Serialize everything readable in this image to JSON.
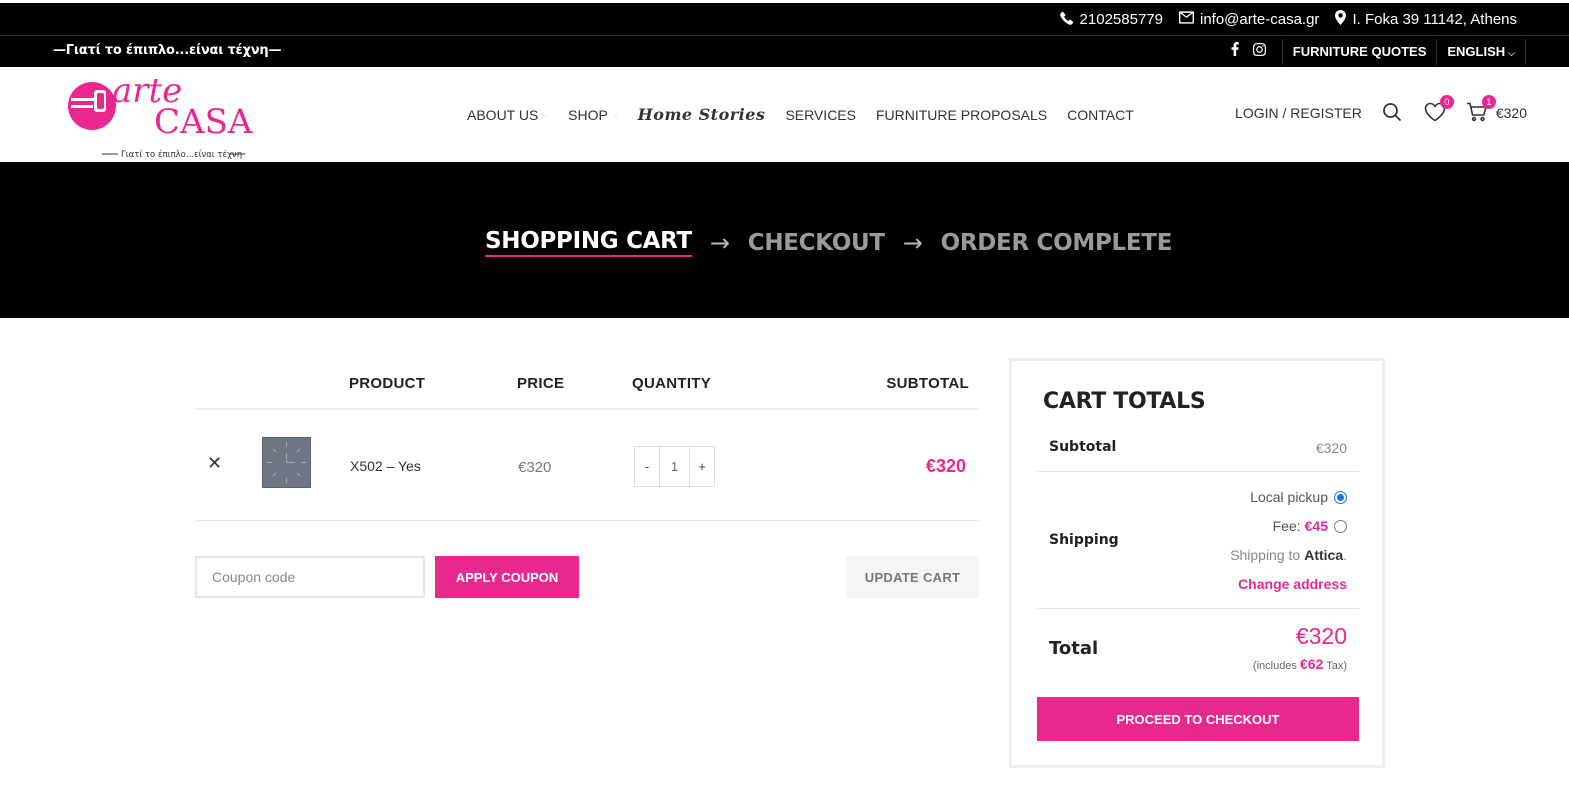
{
  "topbar": {
    "phone": "2102585779",
    "email": "info@arte-casa.gr",
    "address": "I. Foka 39 11142, Athens"
  },
  "subbar": {
    "tagline": "—Γιατί το έπιπλο...είναι τέχνη—",
    "quotes_link": "FURNITURE QUOTES",
    "language": "ENGLISH"
  },
  "logo": {
    "line1": "arte",
    "line2": "CASA",
    "slogan": "Γιατί το έπιπλο...είναι τέχνη"
  },
  "nav": {
    "items": [
      {
        "label": "ABOUT US",
        "has_dropdown": true
      },
      {
        "label": "SHOP",
        "has_dropdown": true
      },
      {
        "label": "Home Stories",
        "has_dropdown": false
      },
      {
        "label": "SERVICES",
        "has_dropdown": false
      },
      {
        "label": "FURNITURE PROPOSALS",
        "has_dropdown": false
      },
      {
        "label": "CONTACT",
        "has_dropdown": false
      }
    ]
  },
  "header_right": {
    "login": "LOGIN / REGISTER",
    "wishlist_count": "0",
    "cart_count": "1",
    "cart_total": "€320"
  },
  "steps": {
    "shopping_cart": "SHOPPING CART",
    "checkout": "CHECKOUT",
    "order_complete": "ORDER COMPLETE"
  },
  "cart": {
    "headers": {
      "product": "PRODUCT",
      "price": "PRICE",
      "quantity": "QUANTITY",
      "subtotal": "SUBTOTAL"
    },
    "item": {
      "name": "X502 – Yes",
      "price": "€320",
      "quantity": "1",
      "subtotal": "€320"
    },
    "coupon_placeholder": "Coupon code",
    "apply_coupon": "APPLY COUPON",
    "update_cart": "UPDATE CART"
  },
  "totals": {
    "title": "CART TOTALS",
    "subtotal_label": "Subtotal",
    "subtotal_value": "€320",
    "shipping_label": "Shipping",
    "local_pickup": "Local pickup",
    "fee_label": "Fee:",
    "fee_value": "€45",
    "shipping_to": "Shipping to",
    "shipping_region": "Attica",
    "change_address": "Change address",
    "total_label": "Total",
    "total_value": "€320",
    "tax_prefix": "(includes",
    "tax_value": "€62",
    "tax_suffix": "Tax)",
    "proceed": "PROCEED TO CHECKOUT"
  },
  "colors": {
    "accent": "#e9288f",
    "dark": "#000000",
    "radio_selected": "#1a73e8"
  }
}
